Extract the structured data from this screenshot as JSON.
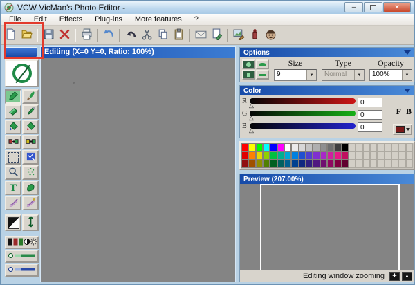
{
  "window": {
    "title": "VCW VicMan's Photo Editor -"
  },
  "menu": {
    "items": [
      "File",
      "Edit",
      "Effects",
      "Plug-ins",
      "More features",
      "?"
    ]
  },
  "toolbar": {
    "buttons": [
      {
        "icon": "new-page",
        "name": "new-button"
      },
      {
        "icon": "open-folder",
        "name": "open-button"
      },
      {
        "sep": true
      },
      {
        "icon": "save-floppy",
        "name": "save-button"
      },
      {
        "icon": "delete-x",
        "name": "delete-button"
      },
      {
        "sep": true
      },
      {
        "icon": "printer",
        "name": "print-button"
      },
      {
        "sep": true
      },
      {
        "icon": "revert-arrow",
        "name": "revert-button"
      },
      {
        "sep": true
      },
      {
        "icon": "undo-arrow",
        "name": "undo-button"
      },
      {
        "icon": "scissors",
        "name": "cut-button"
      },
      {
        "icon": "copy-pages",
        "name": "copy-button"
      },
      {
        "icon": "paste-clipboard",
        "name": "paste-button"
      },
      {
        "sep": true
      },
      {
        "icon": "envelope",
        "name": "send-mail-button"
      },
      {
        "icon": "edit-page",
        "name": "page-setup-button"
      },
      {
        "sep": true
      },
      {
        "icon": "image-edit",
        "name": "image-options-button"
      },
      {
        "icon": "lipstick",
        "name": "vicman-red-button"
      },
      {
        "icon": "face",
        "name": "about-button"
      }
    ]
  },
  "tools": {
    "logo": {
      "icon": "ellipse-logo",
      "name": "ellipse-tool"
    },
    "grid": [
      {
        "icon": "pencil",
        "name": "pencil-tool",
        "selected": true
      },
      {
        "icon": "brush",
        "name": "brush-tool"
      },
      {
        "icon": "eraser",
        "name": "eraser-tool"
      },
      {
        "icon": "pin",
        "name": "pin-tool"
      },
      {
        "icon": "fill-bucket",
        "name": "fill-tool"
      },
      {
        "icon": "fill-bucket-red",
        "name": "fill-alt-tool"
      },
      {
        "icon": "color-replace",
        "name": "color-replace-tool"
      },
      {
        "icon": "color-replace-alt",
        "name": "color-replace-alt-tool"
      },
      {
        "icon": "select-rect",
        "name": "select-tool"
      },
      {
        "icon": "magic-select",
        "name": "magic-select-tool"
      },
      {
        "icon": "magnifier",
        "name": "zoom-tool"
      },
      {
        "icon": "spray",
        "name": "spray-tool"
      },
      {
        "icon": "text-T",
        "name": "text-tool"
      },
      {
        "icon": "shape-blob",
        "name": "shape-tool"
      },
      {
        "icon": "smudge",
        "name": "smudge-tool"
      },
      {
        "icon": "smudge-alt",
        "name": "smudge-alt-tool"
      }
    ],
    "wide": [
      {
        "icon": "bw-diagonal",
        "name": "invert-tool"
      },
      {
        "icon": "resize-arrows",
        "name": "resize-tool"
      }
    ],
    "adjust": [
      {
        "icon": "adjust-colors",
        "name": "adjust-colors-button"
      },
      {
        "icon": "brightness-bar",
        "name": "brightness-button"
      },
      {
        "icon": "contrast-bar",
        "name": "contrast-button"
      }
    ]
  },
  "editing": {
    "title": "Editing (X=0 Y=0, Ratio: 100%)"
  },
  "options": {
    "title": "Options",
    "size_label": "Size",
    "size_value": "9",
    "type_label": "Type",
    "type_value": "Normal",
    "opacity_label": "Opacity",
    "opacity_value": "100%"
  },
  "color": {
    "title": "Color",
    "channels": [
      {
        "label": "R",
        "value": "0"
      },
      {
        "label": "G",
        "value": "0"
      },
      {
        "label": "B",
        "value": "0"
      }
    ],
    "fg_label": "F",
    "bg_label": "B"
  },
  "palette": {
    "rows": [
      [
        "#ff0000",
        "#ffff00",
        "#00ff00",
        "#00ffff",
        "#0000ff",
        "#ff00ff",
        "#ffffff",
        "#ebebeb",
        "#d7d7d7",
        "#c3c3c3",
        "#afafaf",
        "#8f8f8f",
        "#6f6f6f",
        "#3f3f3f",
        "#000000",
        null,
        null,
        null,
        null,
        null,
        null,
        null,
        null,
        null
      ],
      [
        "#e00000",
        "#ff8000",
        "#e8d800",
        "#90d000",
        "#00c040",
        "#00b090",
        "#00a8d8",
        "#0080e0",
        "#2050d0",
        "#5040d0",
        "#8030d0",
        "#a828c8",
        "#d020a0",
        "#e81888",
        "#c01060",
        null,
        null,
        null,
        null,
        null,
        null,
        null,
        null,
        null
      ],
      [
        "#901010",
        "#a05000",
        "#909000",
        "#508000",
        "#006020",
        "#006060",
        "#006090",
        "#004090",
        "#102880",
        "#302080",
        "#501880",
        "#701070",
        "#900860",
        "#800040",
        "#600030",
        null,
        null,
        null,
        null,
        null,
        null,
        null,
        null,
        null
      ]
    ]
  },
  "preview": {
    "title": "Preview (207.00%)"
  },
  "statusbar": {
    "label": "Editing window zooming",
    "zoom_in": "+",
    "zoom_out": "-"
  },
  "theme": {
    "panel_header_blue": "#1a50b2",
    "canvas_gray": "#848484",
    "chrome_gray": "#d8d4cc",
    "desktop_blue": "#b9d2e5",
    "highlight_red": "#e23a2c"
  }
}
